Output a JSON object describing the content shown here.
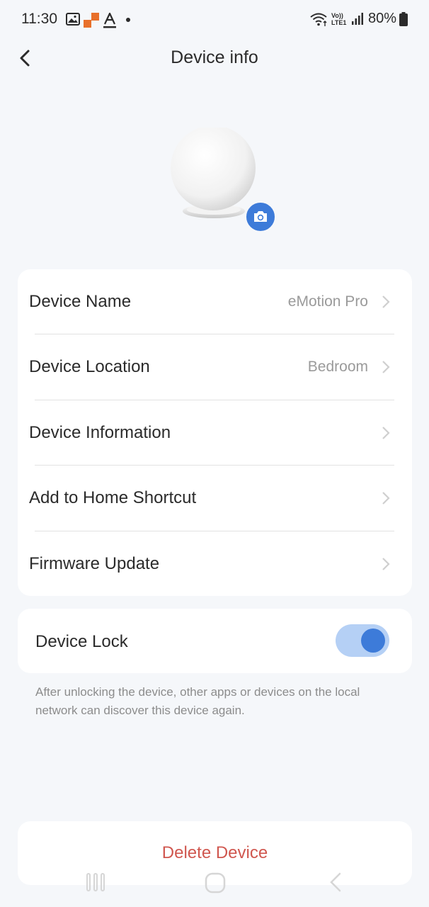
{
  "status_bar": {
    "time": "11:30",
    "battery": "80%",
    "icons": [
      "gallery-icon",
      "app-notification-icon",
      "text-a-icon",
      "dot-icon",
      "wifi-icon",
      "volte-icon",
      "signal-icon",
      "battery-icon"
    ],
    "volte_text": "Vo)) LTE1"
  },
  "header": {
    "title": "Device info",
    "back_icon": "chevron-left-icon"
  },
  "device": {
    "image_icon": "motion-sensor-orb",
    "camera_icon": "camera-icon"
  },
  "settings": [
    {
      "label": "Device Name",
      "value": "eMotion Pro"
    },
    {
      "label": "Device Location",
      "value": "Bedroom"
    },
    {
      "label": "Device Information",
      "value": ""
    },
    {
      "label": "Add to Home Shortcut",
      "value": ""
    },
    {
      "label": "Firmware Update",
      "value": ""
    }
  ],
  "device_lock": {
    "label": "Device Lock",
    "enabled": true,
    "help_text": "After unlocking the device, other apps or devices on the local network can discover this device again."
  },
  "delete": {
    "label": "Delete Device"
  },
  "nav_bar": {
    "icons": [
      "recents-icon",
      "home-icon",
      "back-icon"
    ]
  },
  "colors": {
    "accent": "#3d7bd9",
    "toggle_track": "#b5d0f5",
    "danger": "#d0574f",
    "background": "#f5f7fa"
  }
}
